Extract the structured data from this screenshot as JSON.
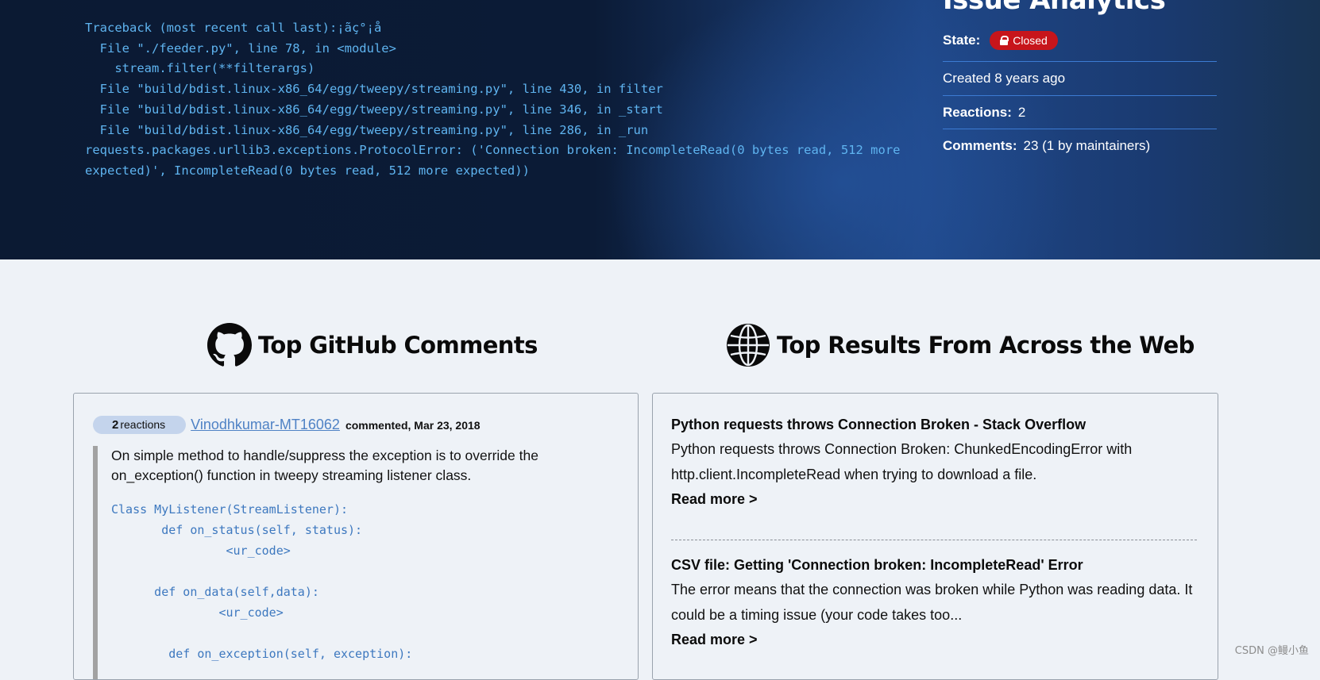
{
  "hero": {
    "traceback": "Traceback (most recent call last):¡ãç°¡å\n  File \"./feeder.py\", line 78, in <module>\n    stream.filter(**filterargs)\n  File \"build/bdist.linux-x86_64/egg/tweepy/streaming.py\", line 430, in filter\n  File \"build/bdist.linux-x86_64/egg/tweepy/streaming.py\", line 346, in _start\n  File \"build/bdist.linux-x86_64/egg/tweepy/streaming.py\", line 286, in _run\nrequests.packages.urllib3.exceptions.ProtocolError: ('Connection broken: IncompleteRead(0 bytes read, 512 more expected)', IncompleteRead(0 bytes read, 512 more expected))",
    "analytics_title": "Issue Analytics",
    "state_label": "State:",
    "state_value": "Closed",
    "created": "Created 8 years ago",
    "reactions_label": "Reactions:",
    "reactions_value": "2",
    "comments_label": "Comments:",
    "comments_value": "23 (1 by maintainers)"
  },
  "github_section": {
    "title": "Top GitHub Comments",
    "icon": "github-icon",
    "comment": {
      "reactions_count": "2",
      "reactions_label": "reactions",
      "author": "Vinodhkumar-MT16062",
      "date": "commented, Mar 23, 2018",
      "text": "On simple method to handle/suppress the exception is to override the on_exception() function in tweepy streaming listener class.",
      "code": "Class MyListener(StreamListener):\n       def on_status(self, status):\n                <ur_code>\n\n      def on_data(self,data):\n               <ur_code>\n\n        def on_exception(self, exception):"
    }
  },
  "web_section": {
    "title": "Top Results From Across the Web",
    "icon": "globe-icon",
    "results": [
      {
        "title": "Python requests throws Connection Broken - Stack Overflow",
        "snippet": "Python requests throws Connection Broken: ChunkedEncodingError with http.client.IncompleteRead when trying to download a file.",
        "read_more": "Read more >"
      },
      {
        "title": "CSV file: Getting 'Connection broken: IncompleteRead' Error",
        "snippet": "The error means that the connection was broken while Python was reading data. It could be a timing issue (your code takes too...",
        "read_more": "Read more >"
      }
    ]
  },
  "watermark": "CSDN @鳗小鱼",
  "colors": {
    "closed_badge": "#c7151b",
    "trace_text": "#5fb4f0",
    "author_link": "#4f82c5",
    "code_text": "#3d78bf"
  }
}
